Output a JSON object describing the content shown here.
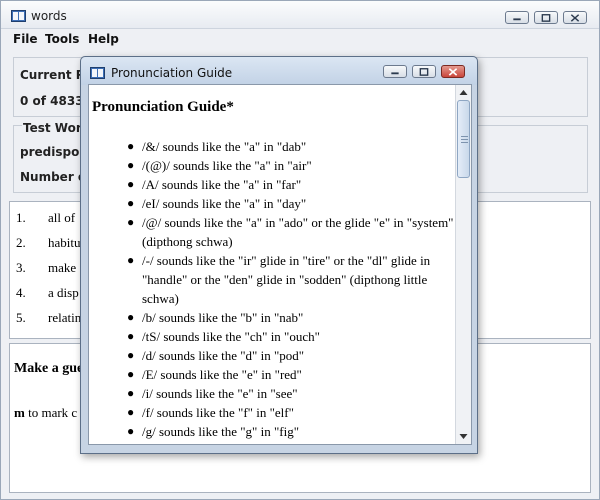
{
  "main_window": {
    "title": "words",
    "menu": [
      "File",
      "Tools",
      "Help"
    ],
    "progress_panel": {
      "label": "Current Pr",
      "value": "0 of 4833 r"
    },
    "test_panel": {
      "label": "Test Word",
      "word": "predispose",
      "count_label": "Number of"
    },
    "definitions": [
      {
        "num": "1.",
        "text": "all of"
      },
      {
        "num": "2.",
        "text": "habitu"
      },
      {
        "num": "3.",
        "text": "make"
      },
      {
        "num": "4.",
        "text": "a disp"
      },
      {
        "num": "5.",
        "text": "relatin"
      }
    ],
    "guess": {
      "title": "Make a gue",
      "hint_key": "m",
      "hint_text": "to mark c"
    }
  },
  "dialog": {
    "title": "Pronunciation Guide",
    "heading": "Pronunciation Guide*",
    "items": [
      "/&/ sounds like the \"a\" in \"dab\"",
      "/(@)/ sounds like the \"a\" in \"air\"",
      "/A/ sounds like the \"a\" in \"far\"",
      "/eI/ sounds like the \"a\" in \"day\"",
      "/@/ sounds like the \"a\" in \"ado\" or the glide \"e\" in \"system\" (dipthong schwa)",
      "/-/ sounds like the \"ir\" glide in \"tire\" or the \"dl\" glide in \"handle\" or the \"den\" glide in \"sodden\" (dipthong little schwa)",
      "/b/ sounds like the \"b\" in \"nab\"",
      "/tS/ sounds like the \"ch\" in \"ouch\"",
      "/d/ sounds like the \"d\" in \"pod\"",
      "/E/ sounds like the \"e\" in \"red\"",
      "/i/ sounds like the \"e\" in \"see\"",
      "/f/ sounds like the \"f\" in \"elf\"",
      "/g/ sounds like the \"g\" in \"fig\""
    ]
  },
  "icons": {
    "app": "book-icon",
    "minimize": "minimize-icon",
    "maximize": "maximize-icon",
    "close": "close-icon",
    "bullet": "●"
  },
  "colors": {
    "close_button": "#c9453a",
    "dialog_frame": "#c7d4e4"
  }
}
